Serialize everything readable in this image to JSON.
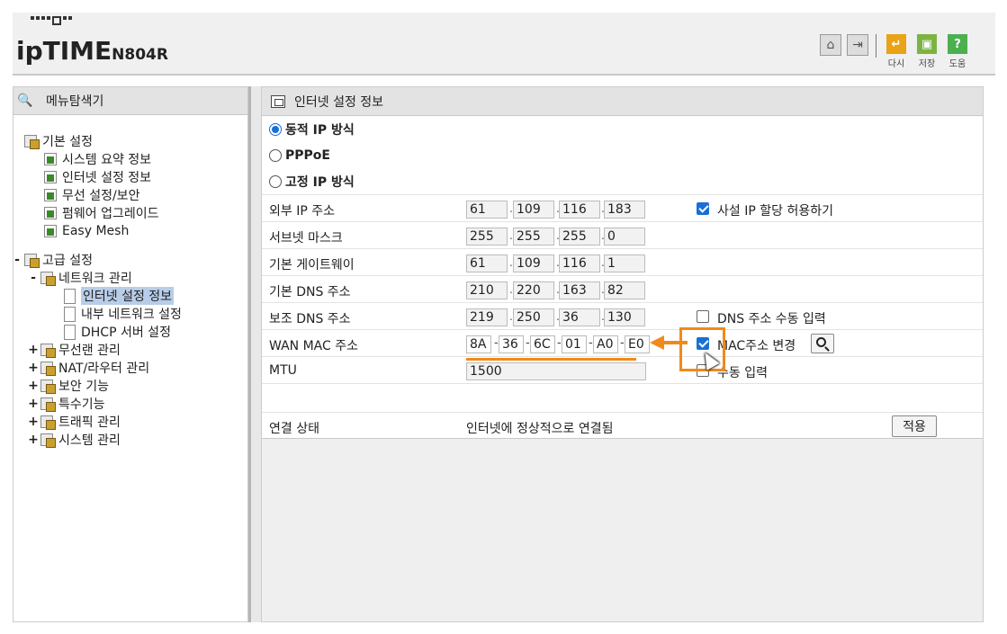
{
  "header": {
    "brand": "ipTIME",
    "model": "N804R",
    "actions": [
      {
        "label": "다시",
        "color": "#e8a317"
      },
      {
        "label": "저장",
        "color": "#7cb342"
      },
      {
        "label": "도움",
        "color": "#4caf50"
      }
    ],
    "icons": [
      "home-icon",
      "logout-icon"
    ]
  },
  "sidebar": {
    "title": "메뉴탐색기",
    "basic": {
      "label": "기본 설정",
      "items": [
        "시스템 요약 정보",
        "인터넷 설정 정보",
        "무선 설정/보안",
        "펌웨어 업그레이드",
        "Easy Mesh"
      ]
    },
    "advanced": {
      "toggle": "-",
      "label": "고급 설정",
      "network": {
        "toggle": "-",
        "label": "네트워크 관리",
        "items": [
          "인터넷 설정 정보",
          "내부 네트워크 설정",
          "DHCP 서버 설정"
        ]
      },
      "groups": [
        {
          "toggle": "+",
          "label": "무선랜 관리"
        },
        {
          "toggle": "+",
          "label": "NAT/라우터 관리"
        },
        {
          "toggle": "+",
          "label": "보안 기능"
        },
        {
          "toggle": "+",
          "label": "특수기능"
        },
        {
          "toggle": "+",
          "label": "트래픽 관리"
        },
        {
          "toggle": "+",
          "label": "시스템 관리"
        }
      ]
    }
  },
  "main": {
    "title": "인터넷 설정 정보",
    "connection_types": [
      {
        "label": "동적 IP 방식",
        "selected": true
      },
      {
        "label": "PPPoE",
        "selected": false
      },
      {
        "label": "고정 IP 방식",
        "selected": false
      }
    ],
    "rows": {
      "wan_ip": {
        "label": "외부 IP 주소",
        "octets": [
          "61",
          "109",
          "116",
          "183"
        ]
      },
      "subnet": {
        "label": "서브넷 마스크",
        "octets": [
          "255",
          "255",
          "255",
          "0"
        ]
      },
      "gateway": {
        "label": "기본 게이트웨이",
        "octets": [
          "61",
          "109",
          "116",
          "1"
        ]
      },
      "dns1": {
        "label": "기본 DNS 주소",
        "octets": [
          "210",
          "220",
          "163",
          "82"
        ]
      },
      "dns2": {
        "label": "보조 DNS 주소",
        "octets": [
          "219",
          "250",
          "36",
          "130"
        ]
      },
      "mac": {
        "label": "WAN MAC 주소",
        "parts": [
          "8A",
          "36",
          "6C",
          "01",
          "A0",
          "E0"
        ]
      },
      "mtu": {
        "label": "MTU",
        "value": "1500"
      }
    },
    "options": {
      "private_ip": {
        "label": "사설 IP 할당 허용하기",
        "checked": true
      },
      "dns_manual": {
        "label": "DNS 주소 수동 입력",
        "checked": false
      },
      "mac_change": {
        "label": "MAC주소 변경",
        "checked": true
      },
      "mtu_manual": {
        "label": "수동 입력",
        "checked": false
      }
    },
    "status": {
      "label": "연결 상태",
      "value": "인터넷에 정상적으로 연결됨"
    },
    "apply_label": "적용"
  },
  "annotation_color": "#f08a1a"
}
